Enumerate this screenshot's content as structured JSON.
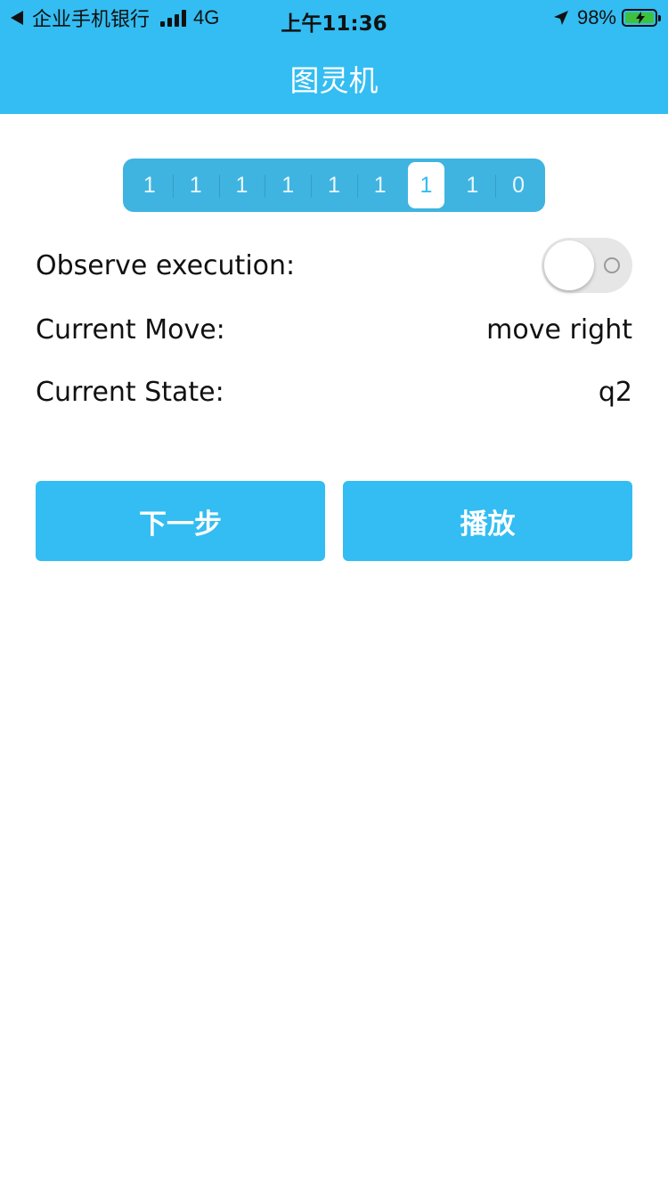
{
  "status_bar": {
    "back_app": "企业手机银行",
    "network": "4G",
    "time": "上午11:36",
    "battery": "98%",
    "battery_level": 0.98,
    "battery_color": "#3ec23e",
    "icons": [
      "back-icon",
      "signal-icon",
      "location-icon",
      "battery-charging-icon"
    ]
  },
  "nav": {
    "title": "图灵机",
    "color": "#33bdf2"
  },
  "tape": {
    "cells": [
      "1",
      "1",
      "1",
      "1",
      "1",
      "1",
      "1",
      "1",
      "0"
    ],
    "head_index": 6
  },
  "observe": {
    "label": "Observe execution:",
    "enabled": false
  },
  "current_move": {
    "label": "Current Move:",
    "value": "move right"
  },
  "current_state": {
    "label": "Current State:",
    "value": "q2"
  },
  "buttons": {
    "next_label": "下一步",
    "play_label": "播放"
  }
}
